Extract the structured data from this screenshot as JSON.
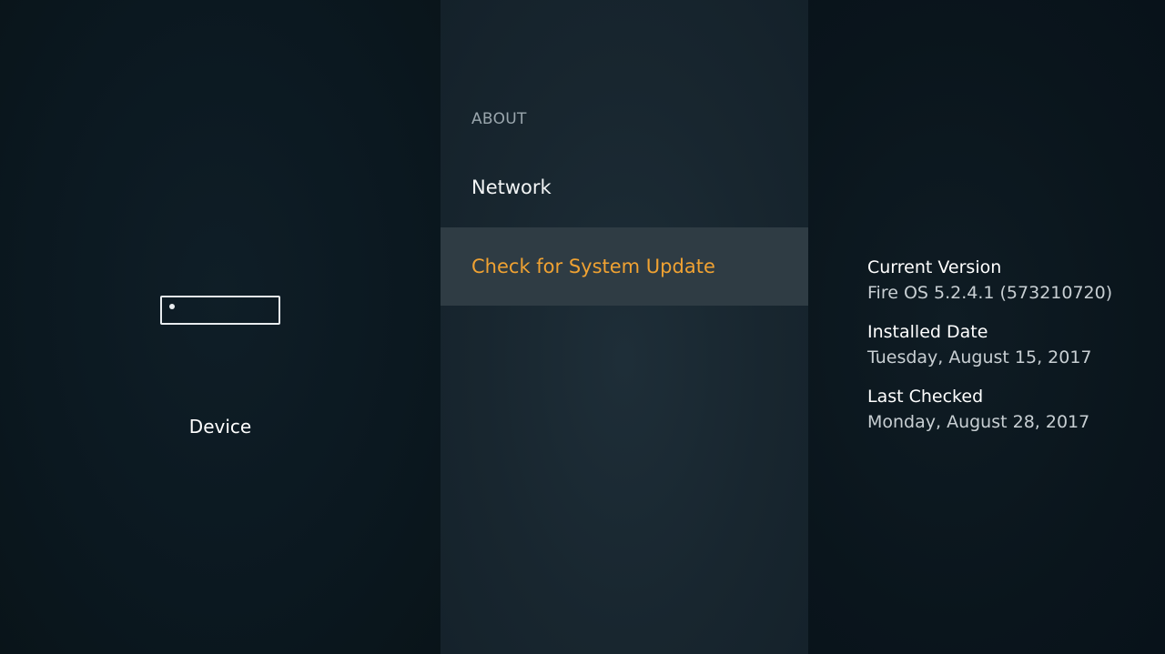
{
  "device_panel": {
    "icon": "fire-tv-device-icon",
    "label": "Device"
  },
  "menu": {
    "section_header": "ABOUT",
    "items": [
      {
        "label": "Network",
        "selected": false
      },
      {
        "label": "Check for System Update",
        "selected": true
      }
    ]
  },
  "details": {
    "current_version_title": "Current Version",
    "current_version_value": "Fire OS 5.2.4.1 (573210720)",
    "installed_date_title": "Installed Date",
    "installed_date_value": "Tuesday, August 15, 2017",
    "last_checked_title": "Last Checked",
    "last_checked_value": "Monday, August 28, 2017"
  },
  "colors": {
    "selected_text": "#f0a232",
    "selected_background": "#2f3c44",
    "background": "#0d1820"
  }
}
